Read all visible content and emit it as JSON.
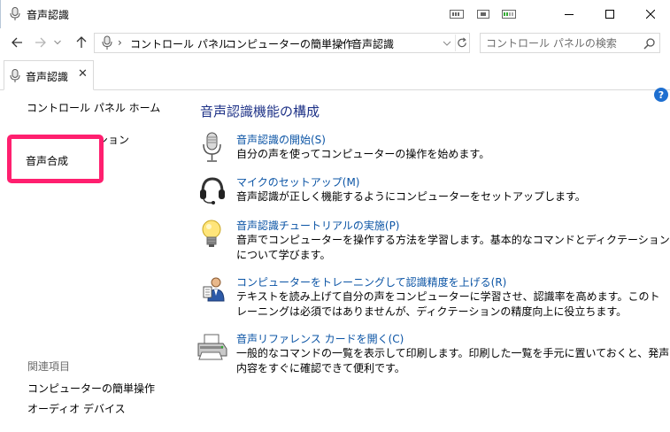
{
  "window": {
    "title": "音声認識"
  },
  "address": {
    "crumbs": [
      "コントロール パネル",
      "コンピューターの簡単操作",
      "音声認識"
    ],
    "search_placeholder": "コントロール パネルの検索"
  },
  "tab": {
    "label": "音声認識"
  },
  "left": {
    "home": "コントロール パネル ホーム",
    "hidden_option": "オプション",
    "tts": "音声合成",
    "related_header": "関連項目",
    "related": [
      "コンピューターの簡単操作",
      "オーディオ デバイス"
    ]
  },
  "main": {
    "heading": "音声認識機能の構成",
    "items": [
      {
        "icon": "microphone-icon",
        "link": "音声認識の開始(S)",
        "desc": "自分の声を使ってコンピューターの操作を始めます。"
      },
      {
        "icon": "headset-icon",
        "link": "マイクのセットアップ(M)",
        "desc": "音声認識が正しく機能するようにコンピューターをセットアップします。"
      },
      {
        "icon": "lightbulb-icon",
        "link": "音声認識チュートリアルの実施(P)",
        "desc": "音声でコンピューターを操作する方法を学習します。基本的なコマンドとディクテーションについて学びます。"
      },
      {
        "icon": "user-training-icon",
        "link": "コンピューターをトレーニングして認識精度を上げる(R)",
        "desc": "テキストを読み上げて自分の声をコンピューターに学習させ、認識率を高めます。このトレーニングは必須ではありませんが、ディクテーションの精度向上に役立ちます。"
      },
      {
        "icon": "printer-icon",
        "link": "音声リファレンス カードを開く(C)",
        "desc": "一般的なコマンドの一覧を表示して印刷します。印刷した一覧を手元に置いておくと、発声内容をすぐに確認できて便利です。"
      }
    ]
  },
  "colors": {
    "link": "#0b54a5",
    "heading": "#1e3287",
    "highlight": "#ff1f6f"
  }
}
